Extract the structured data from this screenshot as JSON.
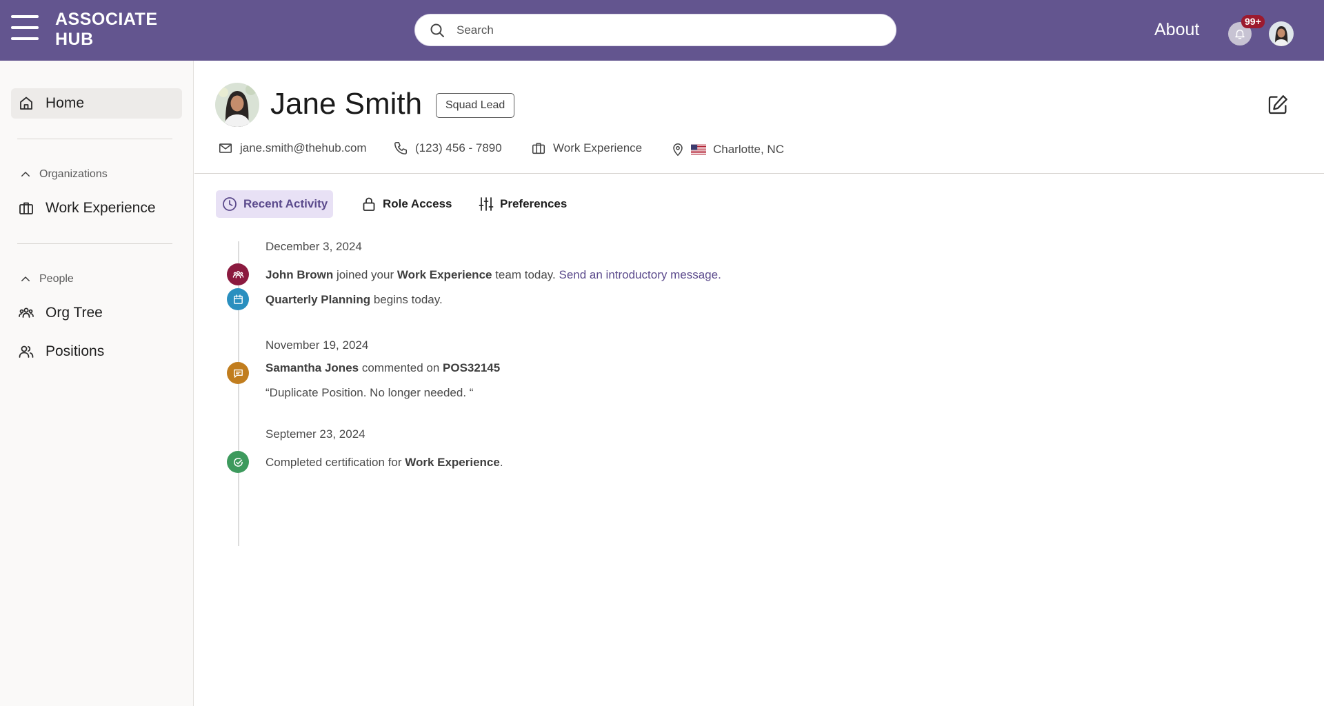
{
  "header": {
    "logo_line1": "ASSOCIATE",
    "logo_line2": "HUB",
    "search_placeholder": "Search",
    "about_label": "About",
    "notification_count": "99+"
  },
  "sidebar": {
    "home_label": "Home",
    "organizations_label": "Organizations",
    "work_experience_label": "Work Experience",
    "people_label": "People",
    "org_tree_label": "Org Tree",
    "positions_label": "Positions"
  },
  "profile": {
    "name": "Jane Smith",
    "role": "Squad Lead",
    "email": "jane.smith@thehub.com",
    "phone": "(123) 456 - 7890",
    "organization": "Work Experience",
    "location": "Charlotte, NC"
  },
  "tabs": [
    {
      "label": "Recent Activity",
      "active": true
    },
    {
      "label": "Role Access",
      "active": false
    },
    {
      "label": "Preferences",
      "active": false
    }
  ],
  "timeline": {
    "group1": {
      "date": "December 3, 2024",
      "event1": {
        "actor": "John Brown",
        "text1": " joined your ",
        "org": "Work Experience",
        "text2": " team today. ",
        "link": "Send an introductory message."
      },
      "event2": {
        "subject": "Quarterly Planning",
        "text": " begins today."
      }
    },
    "group2": {
      "date": "November 19, 2024",
      "event1": {
        "actor": "Samantha Jones",
        "text": " commented on ",
        "target": "POS32145",
        "quote": "“Duplicate Position. No longer needed. “"
      }
    },
    "group3": {
      "date": "Septemer 23, 2024",
      "event1": {
        "text": "Completed certification for ",
        "subject": "Work Experience",
        "end": "."
      }
    }
  },
  "colors": {
    "header_bg": "#63558f",
    "accent": "#5b4a8c",
    "team_event": "#8b1a3f",
    "calendar_event": "#2a8fbf",
    "comment_event": "#c17d1e",
    "cert_event": "#3d9a5d"
  },
  "icons": {
    "menu": "hamburger-icon",
    "search": "search-icon",
    "notifications": "bell-icon",
    "home": "home-icon",
    "organization": "briefcase-icon",
    "people": "people-group-icon",
    "positions": "person-pair-icon",
    "edit": "edit-icon",
    "email": "mail-icon",
    "phone": "phone-icon",
    "location": "location-pin-icon",
    "recent": "clock-icon",
    "role": "lock-icon",
    "preferences": "sliders-icon"
  }
}
